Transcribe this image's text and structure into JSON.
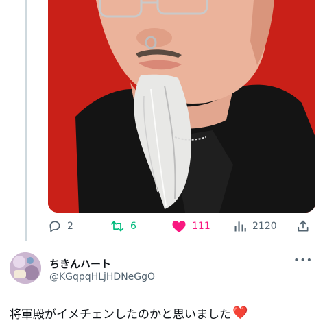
{
  "actions": {
    "reply_count": "2",
    "repost_count": "6",
    "like_count": "111",
    "view_count": "2120"
  },
  "reply": {
    "display_name": "ちきんハート",
    "handle": "@KGqpqHLjHDNeGgO",
    "more_label": "•••",
    "text": "将軍殿がイメチェンしたのかと思いました",
    "emoji": "❤️"
  },
  "colors": {
    "repost": "#00ba7c",
    "like": "#f91880",
    "muted": "#536471",
    "media_background": "#d42219"
  },
  "icons": [
    "reply-icon",
    "repost-icon",
    "like-icon",
    "views-icon",
    "share-icon",
    "more-icon"
  ]
}
